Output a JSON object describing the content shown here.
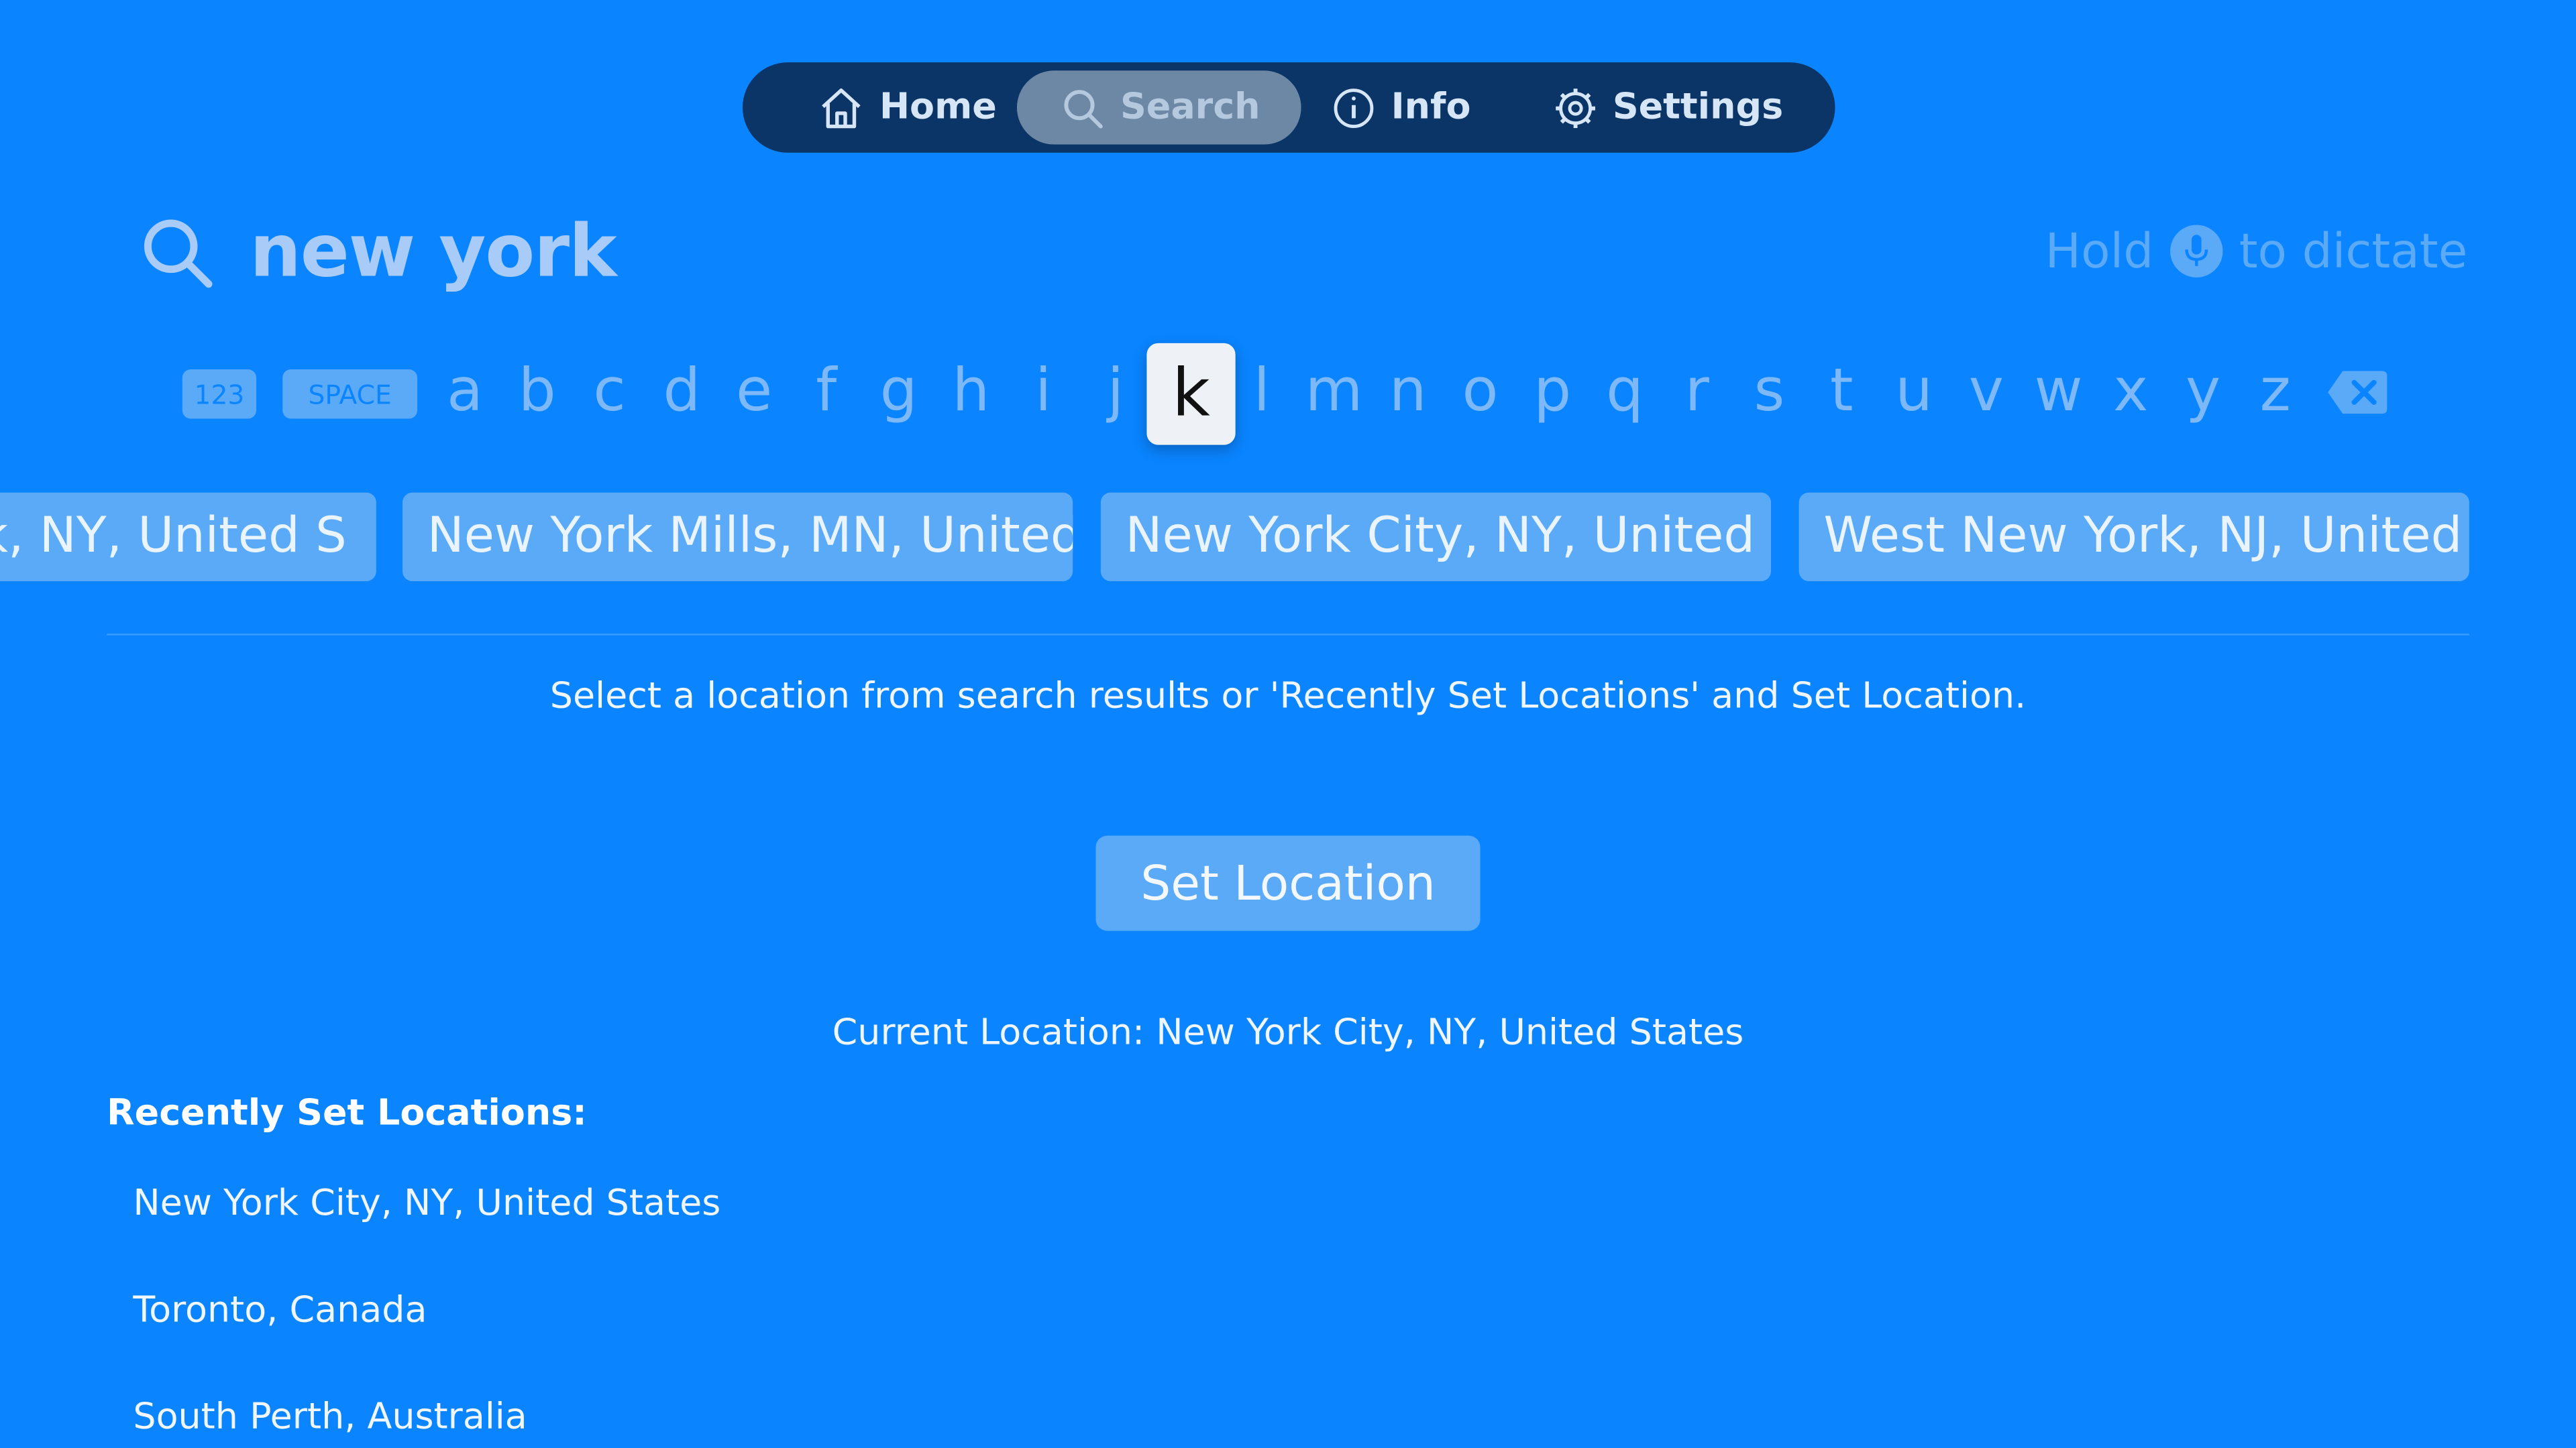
{
  "colors": {
    "background": "#0A84FF",
    "tabbar": "#0B3567",
    "tab_active": "#6D88A5",
    "chip": "#5AAAF8",
    "focused_key": "#EEF1F6"
  },
  "tabs": [
    {
      "label": "Home",
      "icon": "house-icon",
      "active": false
    },
    {
      "label": "Search",
      "icon": "magnifier-icon",
      "active": true
    },
    {
      "label": "Info",
      "icon": "info-circle-icon",
      "active": false
    },
    {
      "label": "Settings",
      "icon": "gear-icon",
      "active": false
    }
  ],
  "search": {
    "query": "new york",
    "icon": "search-icon",
    "dictate_prefix": "Hold",
    "dictate_suffix": "to dictate",
    "dictate_icon": "microphone-icon"
  },
  "keyboard": {
    "numbers_key": "123",
    "space_key": "SPACE",
    "letters": [
      "a",
      "b",
      "c",
      "d",
      "e",
      "f",
      "g",
      "h",
      "i",
      "j",
      "k",
      "l",
      "m",
      "n",
      "o",
      "p",
      "q",
      "r",
      "s",
      "t",
      "u",
      "v",
      "w",
      "x",
      "y",
      "z"
    ],
    "focused_letter": "k",
    "delete_icon": "backspace-icon"
  },
  "results": [
    "New York, NY, United States",
    "New York Mills, MN, United States",
    "New York City, NY, United States",
    "West New York, NJ, United States"
  ],
  "results_visible_text": [
    "ork, NY, United S",
    "New York Mills, MN, United S",
    "New York City, NY, United St",
    "West New York, NJ, United S"
  ],
  "instruction": "Select a location from search results or 'Recently Set Locations' and Set Location.",
  "set_location_button": "Set Location",
  "current_location": "Current Location: New York City, NY, United States",
  "recent": {
    "title": "Recently Set Locations:",
    "items": [
      "New York City, NY, United States",
      "Toronto, Canada",
      "South Perth, Australia"
    ]
  }
}
